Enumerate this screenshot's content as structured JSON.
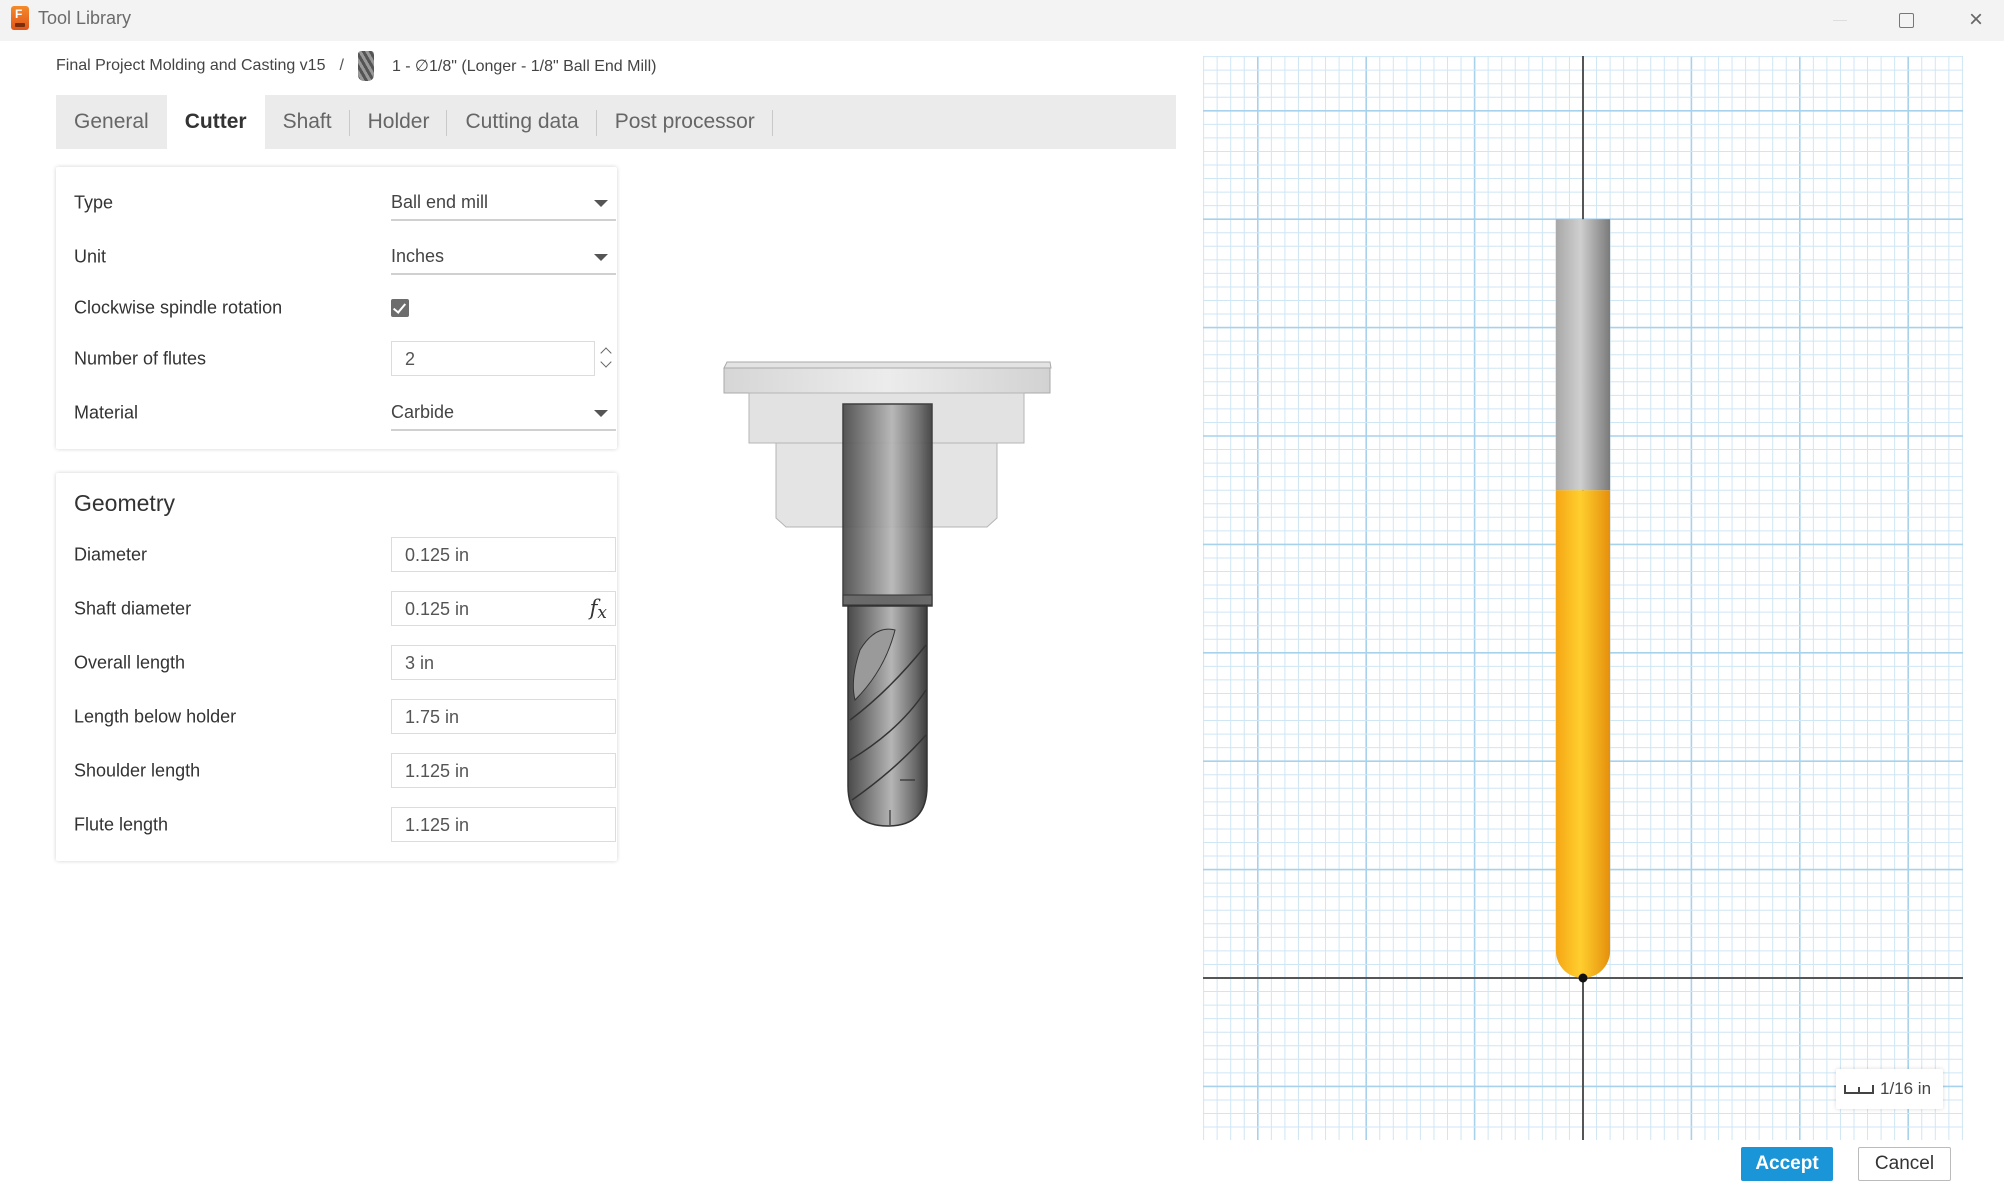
{
  "window": {
    "title": "Tool Library",
    "controls": {
      "minimize": "minimize",
      "maximize": "maximize",
      "close": "×"
    }
  },
  "breadcrumb": {
    "project": "Final Project Molding and Casting v15",
    "separator": "/",
    "tool": "1 - ∅1/8\" (Longer - 1/8\" Ball End Mill)"
  },
  "tabs": [
    {
      "label": "General",
      "active": false
    },
    {
      "label": "Cutter",
      "active": true
    },
    {
      "label": "Shaft",
      "active": false
    },
    {
      "label": "Holder",
      "active": false
    },
    {
      "label": "Cutting data",
      "active": false
    },
    {
      "label": "Post processor",
      "active": false
    }
  ],
  "cutter": {
    "type": {
      "label": "Type",
      "value": "Ball end mill"
    },
    "unit": {
      "label": "Unit",
      "value": "Inches"
    },
    "clockwise": {
      "label": "Clockwise spindle rotation",
      "checked": true
    },
    "flutes": {
      "label": "Number of flutes",
      "value": "2"
    },
    "material": {
      "label": "Material",
      "value": "Carbide"
    }
  },
  "geometry": {
    "title": "Geometry",
    "diameter": {
      "label": "Diameter",
      "value": "0.125 in"
    },
    "shaft_diameter": {
      "label": "Shaft diameter",
      "value": "0.125 in",
      "expression_icon": "fx"
    },
    "overall_length": {
      "label": "Overall length",
      "value": "3 in"
    },
    "length_below_holder": {
      "label": "Length below holder",
      "value": "1.75 in"
    },
    "shoulder_length": {
      "label": "Shoulder length",
      "value": "1.125 in"
    },
    "flute_length": {
      "label": "Flute length",
      "value": "1.125 in"
    }
  },
  "profile_view": {
    "scale_label": "1/16 in",
    "tool_profile_in": {
      "diameter": 0.125,
      "length_below_holder": 1.75,
      "flute_length": 1.125
    },
    "grid_minor_in": 0.03125,
    "colors": {
      "flute": "#f7b21b",
      "shaft": "#b8b8b8",
      "grid_minor": "#cfe6f4",
      "grid_major": "#a8d2ec",
      "axis": "#555555"
    }
  },
  "buttons": {
    "accept": "Accept",
    "cancel": "Cancel"
  },
  "colors": {
    "accent": "#1a95d8"
  }
}
